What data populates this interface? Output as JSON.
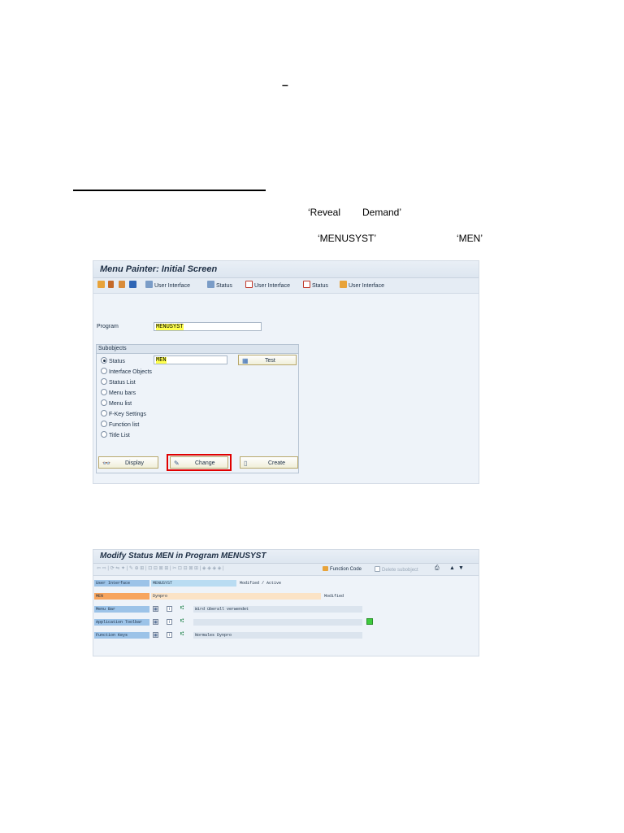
{
  "doc": {
    "dash": "–",
    "quote_reveal": "‘Reveal",
    "quote_demand": "Demand’",
    "quote_menusyst": "‘MENUSYST’",
    "quote_men": "‘MEN’"
  },
  "win1": {
    "title": "Menu Painter: Initial Screen",
    "toolbar": {
      "user_interface_1": "User Interface",
      "status_1": "Status",
      "user_interface_2": "User Interface",
      "status_2": "Status",
      "user_interface_3": "User Interface"
    },
    "program_label": "Program",
    "program_value": "MENUSYST",
    "subobjects_label": "Subobjects",
    "status_value": "MEN",
    "test_label": "Test",
    "radios": [
      "Status",
      "Interface Objects",
      "Status List",
      "Menu bars",
      "Menu list",
      "F-Key Settings",
      "Function list",
      "Title List"
    ],
    "display_label": "Display",
    "change_label": "Change",
    "create_label": "Create"
  },
  "win2": {
    "title": "Modify Status MEN in Program MENUSYST",
    "function_code": "Function Code",
    "delete_subobject": "Delete subobject",
    "rows": {
      "ui_label": "User Interface",
      "ui_value": "MENUSYST",
      "ui_state": "Modified / Active",
      "men_label": "MEN",
      "men_value": "Dynpro",
      "men_state": "Modified",
      "menu_bar_label": "Menu Bar",
      "menu_bar_value": "Wird überall verwendet",
      "app_toolbar_label": "Application Toolbar",
      "fkeys_label": "Function Keys",
      "fkeys_value": "Normales Dynpro"
    }
  },
  "colors": {
    "highlight": "#ffff4d",
    "change_border": "#e00000",
    "row_label_bg": "#9cc3e8",
    "men_bg": "#f7a55e",
    "men_row_bg": "#fbe3c6",
    "status_green": "#3ecb3e"
  }
}
